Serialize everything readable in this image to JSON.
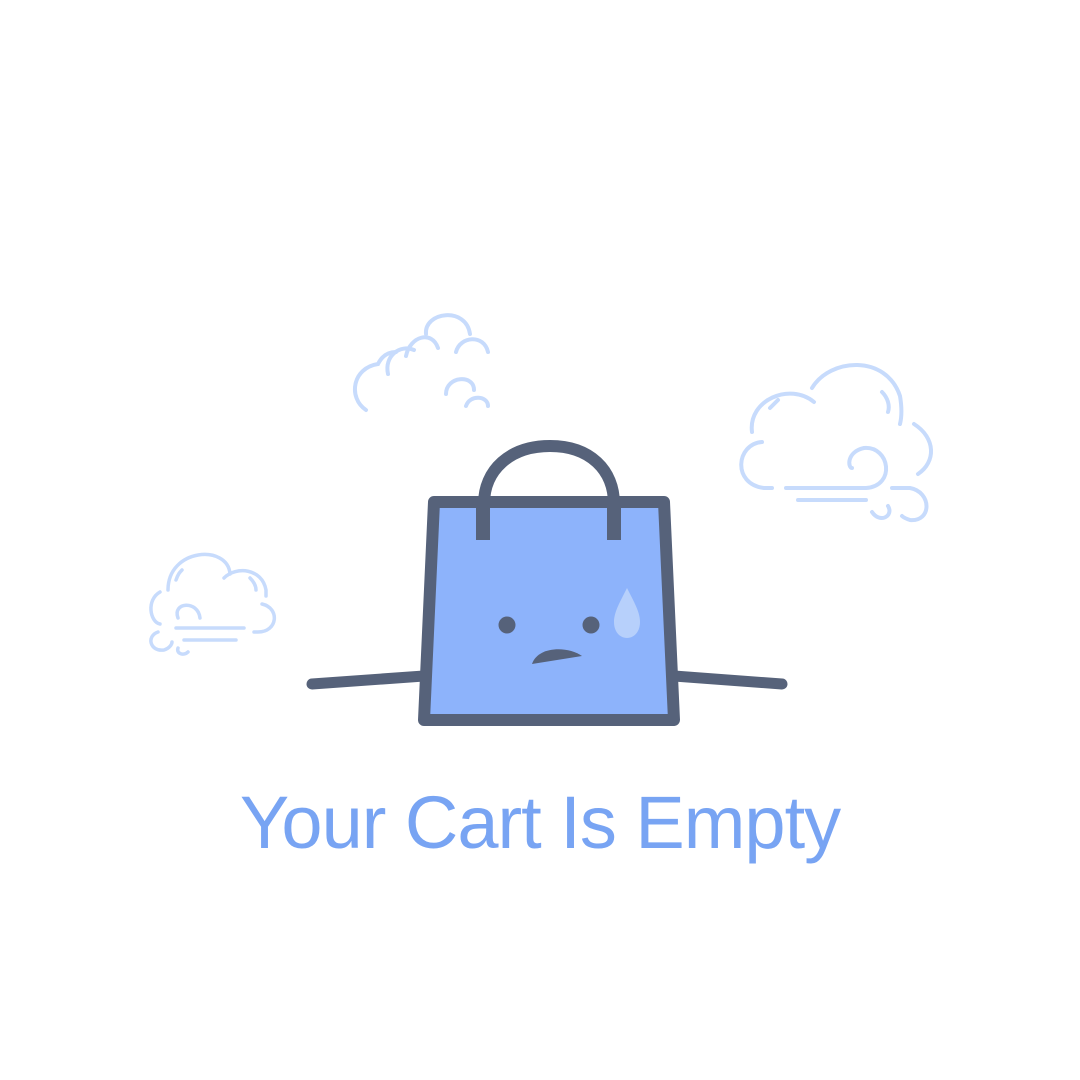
{
  "empty_state": {
    "title": "Your Cart Is Empty",
    "illustration": {
      "bag_icon": "sad-shopping-bag-icon",
      "cloud_icon": "cloud-icon",
      "wind_icon": "wind-cloud-icon",
      "sweat_icon": "sweat-drop-icon"
    }
  },
  "colors": {
    "title": "#78a4f3",
    "bag_fill": "#8db3fb",
    "bag_outline": "#56627a",
    "cloud_stroke": "#c7dbfc",
    "sweat_drop": "#b7d0fb",
    "background": "#ffffff"
  }
}
